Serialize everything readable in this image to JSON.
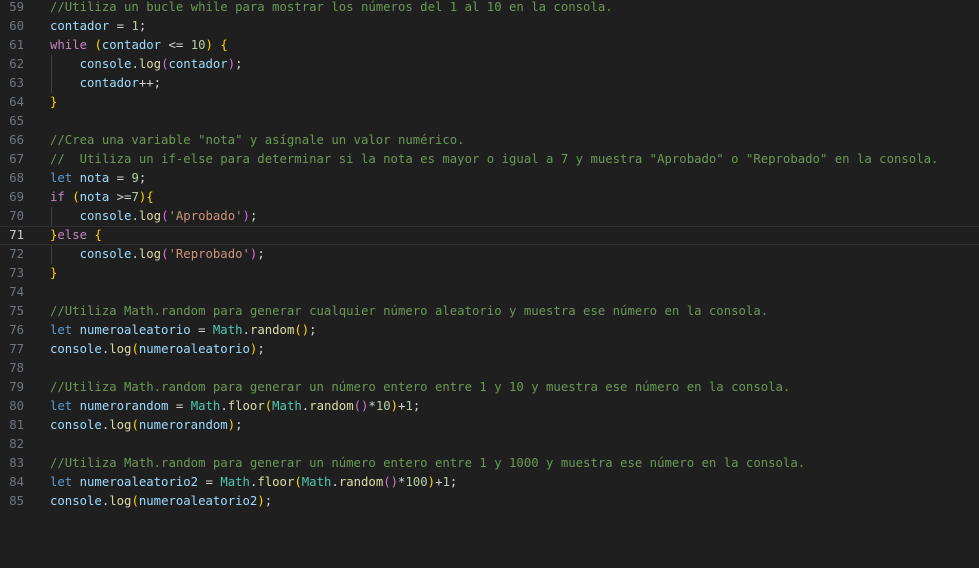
{
  "colors": {
    "background": "#1f1f1f",
    "line_number": "#6e7681",
    "line_number_active": "#cccccc",
    "comment": "#6a9955",
    "variable": "#9cdcfe",
    "keyword": "#569cd6",
    "control_keyword": "#c586c0",
    "number": "#b5cea8",
    "string": "#ce9178",
    "function": "#dcdcaa",
    "class": "#4ec9b0",
    "bracket_level1": "#ffd700",
    "bracket_level2": "#da70d6",
    "bracket_level3": "#179fff"
  },
  "editor": {
    "active_line": 71,
    "lines": [
      {
        "n": 59,
        "tokens": [
          {
            "t": "cmt",
            "v": "//Utiliza un bucle while para mostrar los números del 1 al 10 en la consola."
          }
        ]
      },
      {
        "n": 60,
        "tokens": [
          {
            "t": "var",
            "v": "contador"
          },
          {
            "t": "op",
            "v": " = "
          },
          {
            "t": "num",
            "v": "1"
          },
          {
            "t": "op",
            "v": ";"
          }
        ]
      },
      {
        "n": 61,
        "tokens": [
          {
            "t": "ctl",
            "v": "while"
          },
          {
            "t": "op",
            "v": " "
          },
          {
            "t": "b1",
            "v": "("
          },
          {
            "t": "var",
            "v": "contador"
          },
          {
            "t": "op",
            "v": " <= "
          },
          {
            "t": "num",
            "v": "10"
          },
          {
            "t": "b1",
            "v": ")"
          },
          {
            "t": "op",
            "v": " "
          },
          {
            "t": "b1",
            "v": "{"
          }
        ]
      },
      {
        "n": 62,
        "tokens": [
          {
            "t": "op",
            "v": "    "
          },
          {
            "t": "var",
            "v": "console"
          },
          {
            "t": "op",
            "v": "."
          },
          {
            "t": "fn",
            "v": "log"
          },
          {
            "t": "b2",
            "v": "("
          },
          {
            "t": "var",
            "v": "contador"
          },
          {
            "t": "b2",
            "v": ")"
          },
          {
            "t": "op",
            "v": ";"
          }
        ]
      },
      {
        "n": 63,
        "tokens": [
          {
            "t": "op",
            "v": "    "
          },
          {
            "t": "var",
            "v": "contador"
          },
          {
            "t": "op",
            "v": "++;"
          }
        ]
      },
      {
        "n": 64,
        "tokens": [
          {
            "t": "b1",
            "v": "}"
          }
        ]
      },
      {
        "n": 65,
        "tokens": []
      },
      {
        "n": 66,
        "tokens": [
          {
            "t": "cmt",
            "v": "//Crea una variable \"nota\" y asígnale un valor numérico."
          }
        ]
      },
      {
        "n": 67,
        "tokens": [
          {
            "t": "cmt",
            "v": "//  Utiliza un if-else para determinar si la nota es mayor o igual a 7 y muestra \"Aprobado\" o \"Reprobado\" en la consola."
          }
        ]
      },
      {
        "n": 68,
        "tokens": [
          {
            "t": "kw",
            "v": "let"
          },
          {
            "t": "op",
            "v": " "
          },
          {
            "t": "var",
            "v": "nota"
          },
          {
            "t": "op",
            "v": " = "
          },
          {
            "t": "num",
            "v": "9"
          },
          {
            "t": "op",
            "v": ";"
          }
        ]
      },
      {
        "n": 69,
        "tokens": [
          {
            "t": "ctl",
            "v": "if"
          },
          {
            "t": "op",
            "v": " "
          },
          {
            "t": "b1",
            "v": "("
          },
          {
            "t": "var",
            "v": "nota"
          },
          {
            "t": "op",
            "v": " >="
          },
          {
            "t": "num",
            "v": "7"
          },
          {
            "t": "b1",
            "v": ")"
          },
          {
            "t": "b1",
            "v": "{"
          }
        ]
      },
      {
        "n": 70,
        "tokens": [
          {
            "t": "op",
            "v": "    "
          },
          {
            "t": "var",
            "v": "console"
          },
          {
            "t": "op",
            "v": "."
          },
          {
            "t": "fn",
            "v": "log"
          },
          {
            "t": "b2",
            "v": "("
          },
          {
            "t": "str",
            "v": "'Aprobado'"
          },
          {
            "t": "b2",
            "v": ")"
          },
          {
            "t": "op",
            "v": ";"
          }
        ]
      },
      {
        "n": 71,
        "tokens": [
          {
            "t": "b1",
            "v": "}"
          },
          {
            "t": "ctl",
            "v": "else"
          },
          {
            "t": "op",
            "v": " "
          },
          {
            "t": "b1",
            "v": "{"
          }
        ]
      },
      {
        "n": 72,
        "tokens": [
          {
            "t": "op",
            "v": "    "
          },
          {
            "t": "var",
            "v": "console"
          },
          {
            "t": "op",
            "v": "."
          },
          {
            "t": "fn",
            "v": "log"
          },
          {
            "t": "b2",
            "v": "("
          },
          {
            "t": "str",
            "v": "'Reprobado'"
          },
          {
            "t": "b2",
            "v": ")"
          },
          {
            "t": "op",
            "v": ";"
          }
        ]
      },
      {
        "n": 73,
        "tokens": [
          {
            "t": "b1",
            "v": "}"
          }
        ]
      },
      {
        "n": 74,
        "tokens": []
      },
      {
        "n": 75,
        "tokens": [
          {
            "t": "cmt",
            "v": "//Utiliza Math.random para generar cualquier número aleatorio y muestra ese número en la consola."
          }
        ]
      },
      {
        "n": 76,
        "tokens": [
          {
            "t": "kw",
            "v": "let"
          },
          {
            "t": "op",
            "v": " "
          },
          {
            "t": "var",
            "v": "numeroaleatorio"
          },
          {
            "t": "op",
            "v": " = "
          },
          {
            "t": "cls",
            "v": "Math"
          },
          {
            "t": "op",
            "v": "."
          },
          {
            "t": "fn",
            "v": "random"
          },
          {
            "t": "b1",
            "v": "()"
          },
          {
            "t": "op",
            "v": ";"
          }
        ]
      },
      {
        "n": 77,
        "tokens": [
          {
            "t": "var",
            "v": "console"
          },
          {
            "t": "op",
            "v": "."
          },
          {
            "t": "fn",
            "v": "log"
          },
          {
            "t": "b1",
            "v": "("
          },
          {
            "t": "var",
            "v": "numeroaleatorio"
          },
          {
            "t": "b1",
            "v": ")"
          },
          {
            "t": "op",
            "v": ";"
          }
        ]
      },
      {
        "n": 78,
        "tokens": []
      },
      {
        "n": 79,
        "tokens": [
          {
            "t": "cmt",
            "v": "//Utiliza Math.random para generar un número entero entre 1 y 10 y muestra ese número en la consola."
          }
        ]
      },
      {
        "n": 80,
        "tokens": [
          {
            "t": "kw",
            "v": "let"
          },
          {
            "t": "op",
            "v": " "
          },
          {
            "t": "var",
            "v": "numerorandom"
          },
          {
            "t": "op",
            "v": " = "
          },
          {
            "t": "cls",
            "v": "Math"
          },
          {
            "t": "op",
            "v": "."
          },
          {
            "t": "fn",
            "v": "floor"
          },
          {
            "t": "b1",
            "v": "("
          },
          {
            "t": "cls",
            "v": "Math"
          },
          {
            "t": "op",
            "v": "."
          },
          {
            "t": "fn",
            "v": "random"
          },
          {
            "t": "b2",
            "v": "()"
          },
          {
            "t": "op",
            "v": "*"
          },
          {
            "t": "num",
            "v": "10"
          },
          {
            "t": "b1",
            "v": ")"
          },
          {
            "t": "op",
            "v": "+"
          },
          {
            "t": "num",
            "v": "1"
          },
          {
            "t": "op",
            "v": ";"
          }
        ]
      },
      {
        "n": 81,
        "tokens": [
          {
            "t": "var",
            "v": "console"
          },
          {
            "t": "op",
            "v": "."
          },
          {
            "t": "fn",
            "v": "log"
          },
          {
            "t": "b1",
            "v": "("
          },
          {
            "t": "var",
            "v": "numerorandom"
          },
          {
            "t": "b1",
            "v": ")"
          },
          {
            "t": "op",
            "v": ";"
          }
        ]
      },
      {
        "n": 82,
        "tokens": []
      },
      {
        "n": 83,
        "tokens": [
          {
            "t": "cmt",
            "v": "//Utiliza Math.random para generar un número entero entre 1 y 1000 y muestra ese número en la consola."
          }
        ]
      },
      {
        "n": 84,
        "tokens": [
          {
            "t": "kw",
            "v": "let"
          },
          {
            "t": "op",
            "v": " "
          },
          {
            "t": "var",
            "v": "numeroaleatorio2"
          },
          {
            "t": "op",
            "v": " = "
          },
          {
            "t": "cls",
            "v": "Math"
          },
          {
            "t": "op",
            "v": "."
          },
          {
            "t": "fn",
            "v": "floor"
          },
          {
            "t": "b1",
            "v": "("
          },
          {
            "t": "cls",
            "v": "Math"
          },
          {
            "t": "op",
            "v": "."
          },
          {
            "t": "fn",
            "v": "random"
          },
          {
            "t": "b2",
            "v": "()"
          },
          {
            "t": "op",
            "v": "*"
          },
          {
            "t": "num",
            "v": "100"
          },
          {
            "t": "b1",
            "v": ")"
          },
          {
            "t": "op",
            "v": "+"
          },
          {
            "t": "num",
            "v": "1"
          },
          {
            "t": "op",
            "v": ";"
          }
        ]
      },
      {
        "n": 85,
        "tokens": [
          {
            "t": "var",
            "v": "console"
          },
          {
            "t": "op",
            "v": "."
          },
          {
            "t": "fn",
            "v": "log"
          },
          {
            "t": "b1",
            "v": "("
          },
          {
            "t": "var",
            "v": "numeroaleatorio2"
          },
          {
            "t": "b1",
            "v": ")"
          },
          {
            "t": "op",
            "v": ";"
          }
        ]
      }
    ]
  }
}
